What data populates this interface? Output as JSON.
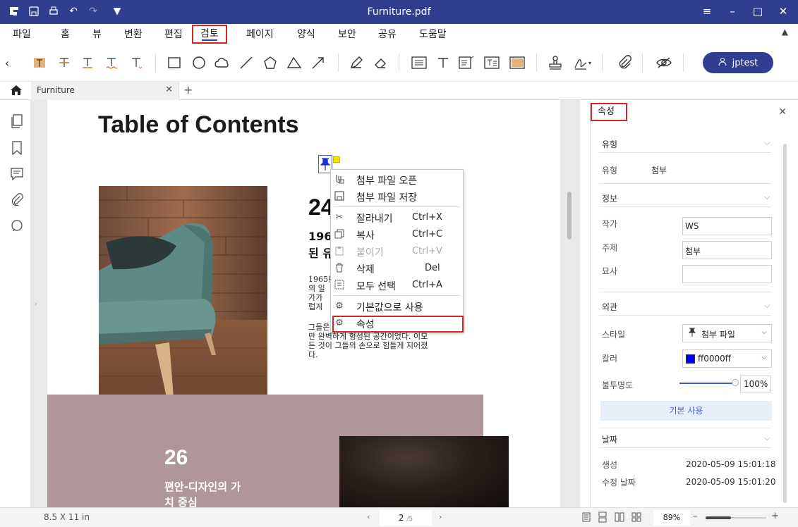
{
  "titlebar": {
    "title": "Furniture.pdf"
  },
  "menu": {
    "items": [
      "파일",
      "홈",
      "뷰",
      "변환",
      "편집",
      "검토",
      "페이지",
      "양식",
      "보안",
      "공유",
      "도움말"
    ],
    "active": "검토"
  },
  "toolbar": {
    "user_label": "jptest"
  },
  "tabs": {
    "doc_tab": "Furniture"
  },
  "document": {
    "title": "Table of Contents",
    "section24": {
      "number": "24",
      "sub_line1": "196",
      "sub_line2": "된 유",
      "body_block1": [
        "1965년",
        "의 일",
        "가가",
        "럽게"
      ],
      "body_block2": [
        "그들은",
        "만 완벽하게 형성된 공간이었다. 이모",
        "든 것이 그들의 손으로 힘들게 지어졌",
        "다."
      ]
    },
    "section26": {
      "number": "26",
      "sub_line1": "편안-디자인의 가",
      "sub_line2": "치 중심"
    }
  },
  "context_menu": {
    "items": [
      {
        "icon": "attachment-open-icon",
        "label": "첨부 파일 오픈",
        "shortcut": ""
      },
      {
        "icon": "save-icon",
        "label": "첨부 파일 저장",
        "shortcut": ""
      },
      {
        "icon": "scissors-icon",
        "label": "잘라내기",
        "shortcut": "Ctrl+X"
      },
      {
        "icon": "copy-icon",
        "label": "복사",
        "shortcut": "Ctrl+C"
      },
      {
        "icon": "paste-icon",
        "label": "붙이기",
        "shortcut": "Ctrl+V",
        "disabled": true
      },
      {
        "icon": "trash-icon",
        "label": "삭제",
        "shortcut": "Del"
      },
      {
        "icon": "select-all-icon",
        "label": "모두 선택",
        "shortcut": "Ctrl+A"
      },
      {
        "icon": "gear-icon",
        "label": "기본값으로 사용",
        "shortcut": ""
      },
      {
        "icon": "gear-icon",
        "label": "속성",
        "shortcut": ""
      }
    ]
  },
  "properties_panel": {
    "title": "속성",
    "type_section": "유형",
    "type_label": "유형",
    "type_value": "첨부",
    "info_section": "정보",
    "author_label": "작가",
    "author_value": "WS",
    "subject_label": "주제",
    "subject_value": "첨부",
    "desc_label": "묘사",
    "desc_value": "",
    "appearance_section": "외관",
    "style_label": "스타일",
    "style_value": "첨부 파일",
    "color_label": "칼러",
    "color_value": "ff0000ff",
    "color_swatch": "#0000ff",
    "opacity_label": "불투명도",
    "opacity_value": "100",
    "opacity_unit": "%",
    "default_button": "기본 사용",
    "date_section": "날짜",
    "created_label": "생성",
    "created_value": "2020-05-09 15:01:18",
    "modified_label": "수정 날짜",
    "modified_value": "2020-05-09 15:01:20"
  },
  "statusbar": {
    "page_size": "8.5 X 11 in",
    "page_current": "2",
    "page_total": "/5",
    "zoom": "89%"
  },
  "colors": {
    "brand": "#2f3e8f",
    "highlight": "#d32626"
  }
}
